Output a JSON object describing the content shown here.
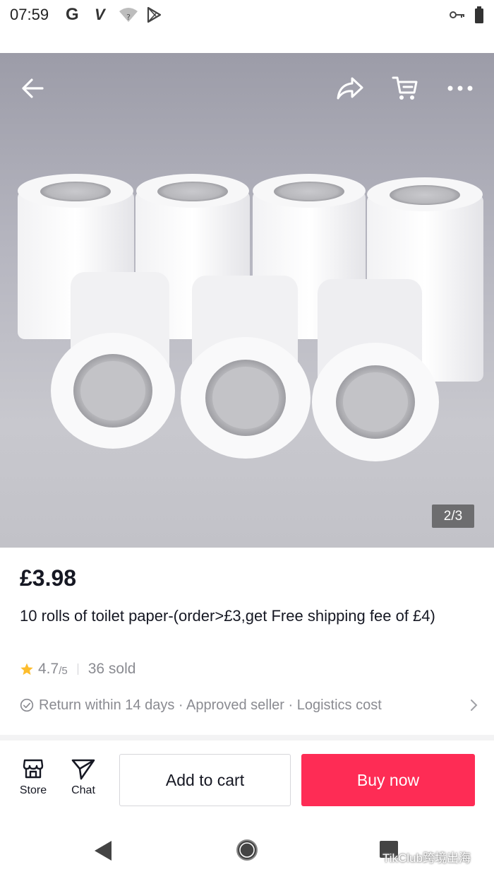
{
  "status_bar": {
    "time": "07:59",
    "icons": [
      "google-g-icon",
      "v-icon",
      "wifi-icon",
      "play-store-icon",
      "vpn-key-icon",
      "battery-icon"
    ],
    "g_label": "G",
    "v_label": "V"
  },
  "hero": {
    "image_alt": "toilet-paper-rolls",
    "pager": "2/3",
    "top_icons": [
      "back-arrow-icon",
      "share-icon",
      "cart-icon",
      "more-icon"
    ]
  },
  "product": {
    "price": "£3.98",
    "title": "10 rolls of toilet paper-(order>£3,get Free shipping fee of £4)",
    "rating": "4.7",
    "rating_suffix": "/5",
    "sold": "36 sold",
    "services": "Return within 14 days · Approved seller · Logistics cost"
  },
  "bottom_bar": {
    "store_label": "Store",
    "chat_label": "Chat",
    "add_to_cart_label": "Add to cart",
    "buy_now_label": "Buy now"
  },
  "watermark": {
    "text": "TikClub跨境出海"
  },
  "colors": {
    "accent": "#fe2c55",
    "star": "#fdbd2d",
    "muted_text": "#8a8b91"
  }
}
